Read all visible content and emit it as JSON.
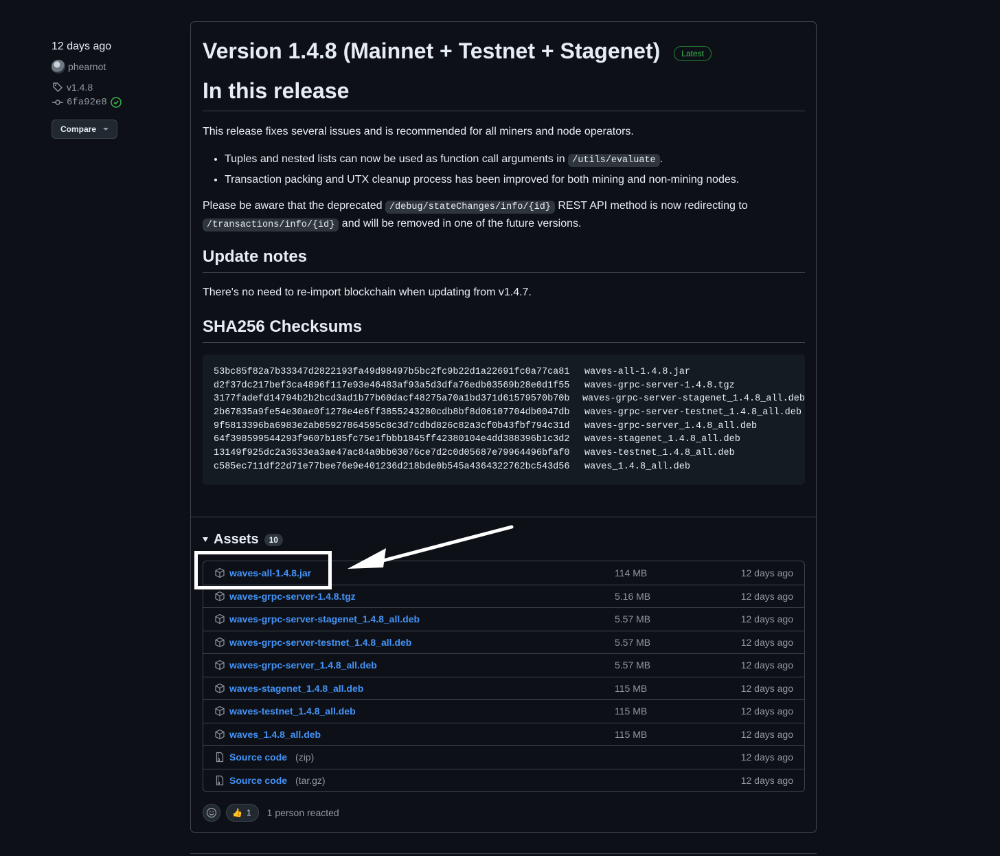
{
  "meta": {
    "date": "12 days ago",
    "author": "phearnot",
    "tag": "v1.4.8",
    "commit": "6fa92e8",
    "compare_label": "Compare"
  },
  "release": {
    "title": "Version 1.4.8 (Mainnet + Testnet + Stagenet)",
    "badge": "Latest",
    "heading_release": "In this release",
    "intro": "This release fixes several issues and is recommended for all miners and node operators.",
    "bullet1_pre": "Tuples and nested lists can now be used as function call arguments in ",
    "bullet1_code": "/utils/evaluate",
    "bullet1_post": ".",
    "bullet2": "Transaction packing and UTX cleanup process has been improved for both mining and non-mining nodes.",
    "deprecated_pre": "Please be aware that the deprecated ",
    "deprecated_code1": "/debug/stateChanges/info/{id}",
    "deprecated_mid": " REST API method is now redirecting to",
    "deprecated_code2": "/transactions/info/{id}",
    "deprecated_post": " and will be removed in one of the future versions.",
    "heading_update": "Update notes",
    "update_text": "There's no need to re-import blockchain when updating from v1.4.7.",
    "heading_checksums": "SHA256 Checksums",
    "checksums": [
      {
        "hash": "53bc85f82a7b33347d2822193fa49d98497b5bc2fc9b22d1a22691fc0a77ca81",
        "file": "waves-all-1.4.8.jar"
      },
      {
        "hash": "d2f37dc217bef3ca4896f117e93e46483af93a5d3dfa76edb03569b28e0d1f55",
        "file": "waves-grpc-server-1.4.8.tgz"
      },
      {
        "hash": "3177fadefd14794b2b2bcd3ad1b77b60dacf48275a70a1bd371d61579570b70b",
        "file": "waves-grpc-server-stagenet_1.4.8_all.deb"
      },
      {
        "hash": "2b67835a9fe54e30ae0f1278e4e6ff3855243280cdb8bf8d06107704db0047db",
        "file": "waves-grpc-server-testnet_1.4.8_all.deb"
      },
      {
        "hash": "9f5813396ba6983e2ab05927864595c8c3d7cdbd826c82a3cf0b43fbf794c31d",
        "file": "waves-grpc-server_1.4.8_all.deb"
      },
      {
        "hash": "64f398599544293f9607b185fc75e1fbbb1845ff42380104e4dd388396b1c3d2",
        "file": "waves-stagenet_1.4.8_all.deb"
      },
      {
        "hash": "13149f925dc2a3633ea3ae47ac84a0bb03076ce7d2c0d05687e79964496bfaf0",
        "file": "waves-testnet_1.4.8_all.deb"
      },
      {
        "hash": "c585ec711df22d71e77bee76e9e401236d218bde0b545a4364322762bc543d56",
        "file": "waves_1.4.8_all.deb"
      }
    ]
  },
  "assets": {
    "label": "Assets",
    "count": "10",
    "items": [
      {
        "name": "waves-all-1.4.8.jar",
        "ext": "",
        "size": "114 MB",
        "date": "12 days ago",
        "icon": "package-icon"
      },
      {
        "name": "waves-grpc-server-1.4.8.tgz",
        "ext": "",
        "size": "5.16 MB",
        "date": "12 days ago",
        "icon": "package-icon"
      },
      {
        "name": "waves-grpc-server-stagenet_1.4.8_all.deb",
        "ext": "",
        "size": "5.57 MB",
        "date": "12 days ago",
        "icon": "package-icon"
      },
      {
        "name": "waves-grpc-server-testnet_1.4.8_all.deb",
        "ext": "",
        "size": "5.57 MB",
        "date": "12 days ago",
        "icon": "package-icon"
      },
      {
        "name": "waves-grpc-server_1.4.8_all.deb",
        "ext": "",
        "size": "5.57 MB",
        "date": "12 days ago",
        "icon": "package-icon"
      },
      {
        "name": "waves-stagenet_1.4.8_all.deb",
        "ext": "",
        "size": "115 MB",
        "date": "12 days ago",
        "icon": "package-icon"
      },
      {
        "name": "waves-testnet_1.4.8_all.deb",
        "ext": "",
        "size": "115 MB",
        "date": "12 days ago",
        "icon": "package-icon"
      },
      {
        "name": "waves_1.4.8_all.deb",
        "ext": "",
        "size": "115 MB",
        "date": "12 days ago",
        "icon": "package-icon"
      },
      {
        "name": "Source code",
        "ext": "(zip)",
        "size": "",
        "date": "12 days ago",
        "icon": "file-zip-icon"
      },
      {
        "name": "Source code",
        "ext": "(tar.gz)",
        "size": "",
        "date": "12 days ago",
        "icon": "file-zip-icon"
      }
    ]
  },
  "reactions": {
    "emoji": "👍",
    "count": "1",
    "summary": "1 person reacted"
  },
  "colors": {
    "background": "#0d1117",
    "link": "#4493f8",
    "badge_green": "#3fb950",
    "annotation": "#ffffff"
  }
}
